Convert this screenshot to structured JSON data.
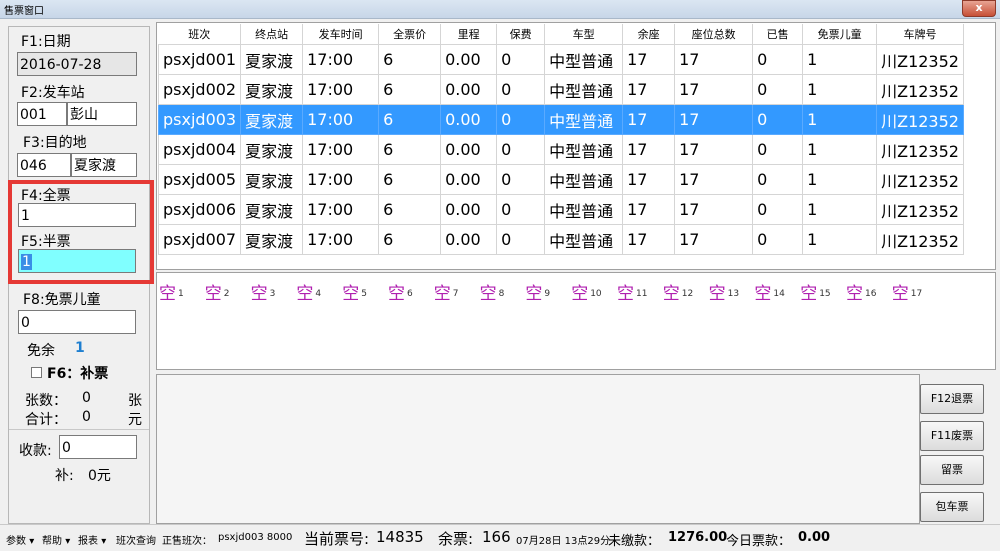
{
  "window": {
    "title": "售票窗口",
    "close": "x"
  },
  "left": {
    "f1_label": "F1:日期",
    "date": "2016-07-28",
    "f2_label": "F2:发车站",
    "dep_code": "001",
    "dep_name": "彭山",
    "f3_label": "F3:目的地",
    "dest_code": "046",
    "dest_name": "夏家渡",
    "f4_label": "F4:全票",
    "full_ticket": "1",
    "f5_label": "F5:半票",
    "half_ticket": "1",
    "f8_label": "F8:免票儿童",
    "child_ticket": "0",
    "free_label": "免余",
    "free_value": "1",
    "f6_label": "F6：补票",
    "count_label": "张数：",
    "count_value": "0",
    "count_unit": "张",
    "total_label": "合计：",
    "total_value": "0",
    "total_unit": "元",
    "receive_label": "收款:",
    "receive_value": "0",
    "change_label": "补:",
    "change_value": "0元"
  },
  "grid": {
    "headers": [
      "班次",
      "终点站",
      "发车时间",
      "全票价",
      "里程",
      "保费",
      "车型",
      "余座",
      "座位总数",
      "已售",
      "免票儿童",
      "车牌号"
    ],
    "rows": [
      [
        "psxjd001",
        "夏家渡",
        "17:00",
        "6",
        "0.00",
        "0",
        "中型普通",
        "17",
        "17",
        "0",
        "1",
        "川Z12352"
      ],
      [
        "psxjd002",
        "夏家渡",
        "17:00",
        "6",
        "0.00",
        "0",
        "中型普通",
        "17",
        "17",
        "0",
        "1",
        "川Z12352"
      ],
      [
        "psxjd003",
        "夏家渡",
        "17:00",
        "6",
        "0.00",
        "0",
        "中型普通",
        "17",
        "17",
        "0",
        "1",
        "川Z12352"
      ],
      [
        "psxjd004",
        "夏家渡",
        "17:00",
        "6",
        "0.00",
        "0",
        "中型普通",
        "17",
        "17",
        "0",
        "1",
        "川Z12352"
      ],
      [
        "psxjd005",
        "夏家渡",
        "17:00",
        "6",
        "0.00",
        "0",
        "中型普通",
        "17",
        "17",
        "0",
        "1",
        "川Z12352"
      ],
      [
        "psxjd006",
        "夏家渡",
        "17:00",
        "6",
        "0.00",
        "0",
        "中型普通",
        "17",
        "17",
        "0",
        "1",
        "川Z12352"
      ],
      [
        "psxjd007",
        "夏家渡",
        "17:00",
        "6",
        "0.00",
        "0",
        "中型普通",
        "17",
        "17",
        "0",
        "1",
        "川Z12352"
      ]
    ],
    "selected_row": 2
  },
  "seats": {
    "label": "空",
    "numbers": [
      "1",
      "2",
      "3",
      "4",
      "5",
      "6",
      "7",
      "8",
      "9",
      "10",
      "11",
      "12",
      "13",
      "14",
      "15",
      "16",
      "17"
    ],
    "color": "#b020b0"
  },
  "buttons": {
    "refund": "F12退票",
    "void": "F11废票",
    "reserve": "留票",
    "charter": "包车票"
  },
  "status": {
    "menu_params": "参数",
    "menu_help": "帮助",
    "menu_report": "报表",
    "menu_schedule": "班次查询",
    "on_sale_label": "正售班次：",
    "on_sale_value": "psxjd003  8000",
    "ticket_no_label": "当前票号:",
    "ticket_no_value": "14835",
    "remaining_label": "余票:",
    "remaining_value": "166",
    "datetime": "07月28日 13点29分",
    "unpaid_label": "未缴款：",
    "unpaid_value": "1276.00",
    "today_label": "今日票款：",
    "today_value": "0.00"
  }
}
